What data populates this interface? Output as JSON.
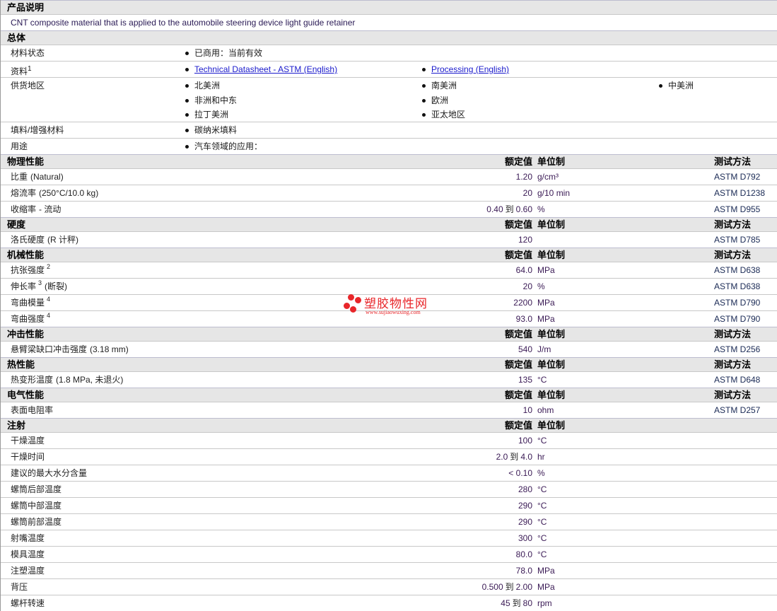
{
  "description": {
    "title": "产品说明",
    "text": "CNT composite material that is applied to the automobile steering device light guide retainer"
  },
  "general": {
    "title": "总体",
    "rows": [
      {
        "label": "材料状态",
        "cols": [
          [
            "已商用：当前有效"
          ]
        ]
      },
      {
        "label": "资料",
        "sup": "1",
        "links": true,
        "cols": [
          [
            "Technical Datasheet - ASTM (English)"
          ],
          [
            "Processing (English)"
          ]
        ]
      },
      {
        "label": "供货地区",
        "cols": [
          [
            "北美洲",
            "非洲和中东",
            "拉丁美洲"
          ],
          [
            "南美洲",
            "欧洲",
            "亚太地区"
          ],
          [
            "中美洲"
          ]
        ]
      },
      {
        "label": "填料/增强材料",
        "cols": [
          [
            "碳纳米填料"
          ]
        ]
      },
      {
        "label": "用途",
        "cols": [
          [
            "汽车领域的应用："
          ]
        ]
      }
    ]
  },
  "headers": {
    "value": "额定值",
    "unit": "单位制",
    "method": "测试方法"
  },
  "range_word": "到",
  "sections": [
    {
      "title": "物理性能",
      "method": true,
      "rows": [
        {
          "label": "比重",
          "note": "(Natural)",
          "value": "1.20",
          "unit": "g/cm³",
          "method": "ASTM D792"
        },
        {
          "label": "熔流率",
          "note": "(250°C/10.0 kg)",
          "value": "20",
          "unit": "g/10 min",
          "method": "ASTM D1238"
        },
        {
          "label": "收缩率",
          "note": "- 流动",
          "value": "0.40",
          "value2": "0.60",
          "unit": "%",
          "method": "ASTM D955"
        }
      ]
    },
    {
      "title": "硬度",
      "method": true,
      "rows": [
        {
          "label": "洛氏硬度",
          "note": "(R 计秤)",
          "value": "120",
          "unit": "",
          "method": "ASTM D785"
        }
      ]
    },
    {
      "title": "机械性能",
      "method": true,
      "rows": [
        {
          "label": "抗张强度",
          "sup": "2",
          "value": "64.0",
          "unit": "MPa",
          "method": "ASTM D638"
        },
        {
          "label": "伸长率",
          "sup": "3",
          "note": "(断裂)",
          "value": "20",
          "unit": "%",
          "method": "ASTM D638"
        },
        {
          "label": "弯曲模量",
          "sup": "4",
          "value": "2200",
          "unit": "MPa",
          "method": "ASTM D790"
        },
        {
          "label": "弯曲强度",
          "sup": "4",
          "value": "93.0",
          "unit": "MPa",
          "method": "ASTM D790"
        }
      ]
    },
    {
      "title": "冲击性能",
      "method": true,
      "rows": [
        {
          "label": "悬臂梁缺口冲击强度",
          "note": "(3.18 mm)",
          "value": "540",
          "unit": "J/m",
          "method": "ASTM D256"
        }
      ]
    },
    {
      "title": "热性能",
      "method": true,
      "rows": [
        {
          "label": "热变形温度",
          "note": "(1.8 MPa, 未退火)",
          "value": "135",
          "unit": "°C",
          "method": "ASTM D648"
        }
      ]
    },
    {
      "title": "电气性能",
      "method": true,
      "rows": [
        {
          "label": "表面电阻率",
          "value": "10",
          "unit": "ohm",
          "method": "ASTM D257"
        }
      ]
    },
    {
      "title": "注射",
      "method": false,
      "rows": [
        {
          "label": "干燥温度",
          "value": "100",
          "unit": "°C"
        },
        {
          "label": "干燥时间",
          "value": "2.0",
          "value2": "4.0",
          "unit": "hr"
        },
        {
          "label": "建议的最大水分含量",
          "value": "< 0.10",
          "unit": "%"
        },
        {
          "label": "螺筒后部温度",
          "value": "280",
          "unit": "°C"
        },
        {
          "label": "螺筒中部温度",
          "value": "290",
          "unit": "°C"
        },
        {
          "label": "螺筒前部温度",
          "value": "290",
          "unit": "°C"
        },
        {
          "label": "射嘴温度",
          "value": "300",
          "unit": "°C"
        },
        {
          "label": "模具温度",
          "value": "80.0",
          "unit": "°C"
        },
        {
          "label": "注塑温度",
          "value": "78.0",
          "unit": "MPa"
        },
        {
          "label": "背压",
          "value": "0.500",
          "value2": "2.00",
          "unit": "MPa"
        },
        {
          "label": "螺杆转速",
          "value": "45",
          "value2": "80",
          "unit": "rpm"
        }
      ]
    }
  ],
  "watermark": {
    "name": "塑胶物性网",
    "url": "www.sujiaowuxing.com"
  }
}
